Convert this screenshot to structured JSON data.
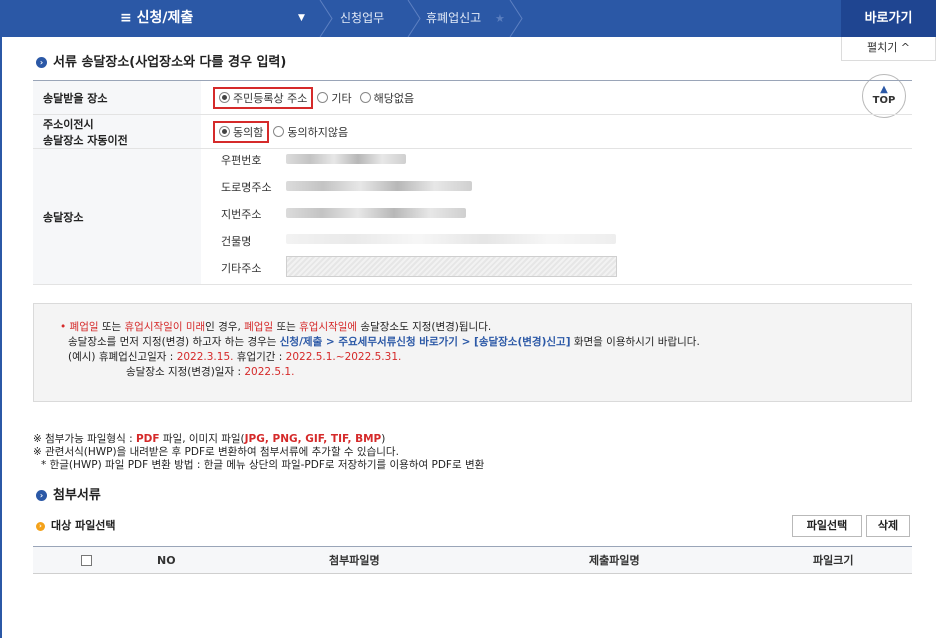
{
  "topbar": {
    "menu": "≡ 신청/제출",
    "dropdown_icon": "▼",
    "crumb1": "신청업무",
    "crumb2": "휴폐업신고",
    "star": "★",
    "goto": "바로가기",
    "expand": "펼치기 ^"
  },
  "section1": {
    "title": "서류 송달장소(사업장소와 다를 경우 입력)"
  },
  "form": {
    "place": {
      "label": "송달받을 장소",
      "opt1": "주민등록상 주소",
      "opt2": "기타",
      "opt3": "해당없음"
    },
    "move": {
      "label1": "주소이전시",
      "label2": "송달장소 자동이전",
      "opt1": "동의함",
      "opt2": "동의하지않음"
    },
    "addr": {
      "label": "송달장소",
      "zip": "우편번호",
      "road": "도로명주소",
      "lot": "지번주소",
      "building": "건물명",
      "etc": "기타주소"
    }
  },
  "top_button": {
    "icon": "▲",
    "label": "TOP"
  },
  "notice": {
    "l1a": "• ",
    "l1b": "폐업일",
    "l1c": " 또는 ",
    "l1d": "휴업시작일이 미래",
    "l1e": "인 경우, ",
    "l1f": "폐업일",
    "l1g": " 또는 ",
    "l1h": "휴업시작일에",
    "l1i": " 송달장소도 지정(변경)됩니다.",
    "l2a": "송달장소를 먼저 지정(변경) 하고자 하는 경우는 ",
    "l2b": "신청/제출 > 주요세무서류신청 바로가기 > [송달장소(변경)신고]",
    "l2c": " 화면을 이용하시기 바랍니다.",
    "l3a": "(예시) 휴폐업신고일자 : ",
    "l3b": "2022.3.15.",
    "l3c": "   휴업기간 : ",
    "l3d": "2022.5.1.~2022.5.31.",
    "l4a": "송달장소 지정(변경)일자 : ",
    "l4b": "2022.5.1."
  },
  "notes": {
    "n1a": "※ 첨부가능 파일형식 : ",
    "n1b": "PDF",
    "n1c": " 파일, 이미지 파일(",
    "n1d": "JPG, PNG, GIF, TIF, BMP",
    "n1e": ")",
    "n2": "※ 관련서식(HWP)을 내려받은 후 PDF로 변환하여 첨부서류에 추가할 수 있습니다.",
    "n3": "* 한글(HWP) 파일 PDF 변환 방법 : 한글 메뉴 상단의 파일-PDF로 저장하기를 이용하여 PDF로 변환"
  },
  "section2": {
    "title": "첨부서류"
  },
  "section3": {
    "title": "대상 파일선택"
  },
  "buttons": {
    "select": "파일선택",
    "delete": "삭제"
  },
  "grid": {
    "no": "NO",
    "attach": "첨부파일명",
    "submit": "제출파일명",
    "size": "파일크기"
  }
}
